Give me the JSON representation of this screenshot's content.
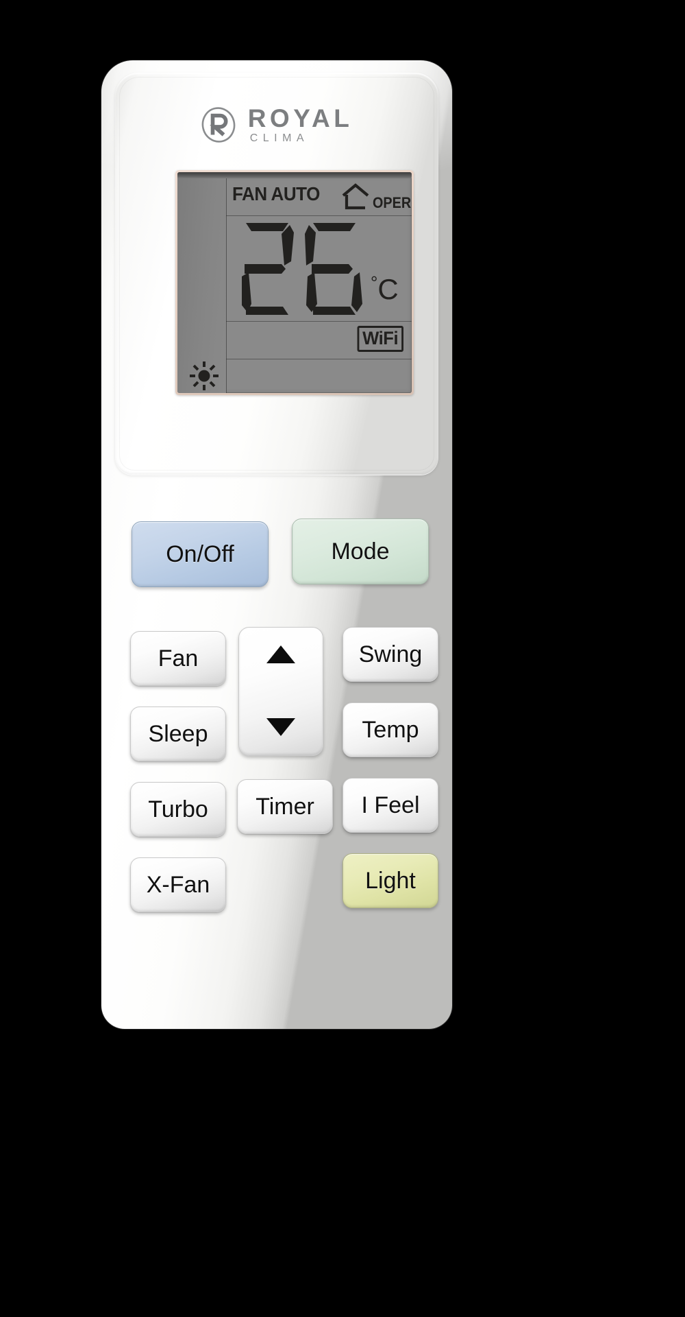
{
  "device": {
    "type": "air-conditioner-remote-control",
    "brand_name": "ROYAL",
    "brand_sub": "CLIMA",
    "brand_color": "#7c7e80",
    "body_color": "#ffffff",
    "background_color": "#000000"
  },
  "display": {
    "screen_bg_color": "#8a8a8a",
    "segment_color": "#22211f",
    "fan_label": "FAN AUTO",
    "oper_label": "OPER",
    "temperature": "26",
    "temp_unit": "°C",
    "degree_symbol": "°",
    "unit_letter": "C",
    "wifi_label": "WiFi",
    "house_icon": "house-icon",
    "sun_icon": "sun-icon"
  },
  "buttons": {
    "power": {
      "label": "On/Off",
      "color": "#bdd0e6"
    },
    "mode": {
      "label": "Mode",
      "color": "#d7e8dc"
    },
    "fan": {
      "label": "Fan",
      "color": "#f2f2f2"
    },
    "swing": {
      "label": "Swing",
      "color": "#f2f2f2"
    },
    "sleep": {
      "label": "Sleep",
      "color": "#f2f2f2"
    },
    "temp": {
      "label": "Temp",
      "color": "#f2f2f2"
    },
    "turbo": {
      "label": "Turbo",
      "color": "#f2f2f2"
    },
    "timer": {
      "label": "Timer",
      "color": "#f2f2f2"
    },
    "ifeel": {
      "label": "I Feel",
      "color": "#f2f2f2"
    },
    "xfan": {
      "label": "X-Fan",
      "color": "#f2f2f2"
    },
    "light": {
      "label": "Light",
      "color": "#e3e8b0"
    },
    "up": {
      "label": "",
      "icon": "triangle-up-icon"
    },
    "down": {
      "label": "",
      "icon": "triangle-down-icon"
    }
  }
}
